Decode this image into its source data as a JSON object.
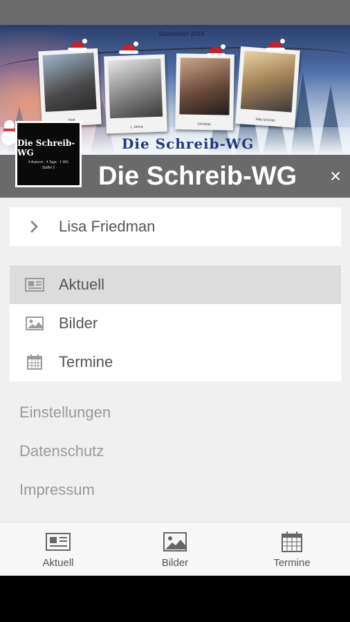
{
  "banner": {
    "month": "Dezember 2018",
    "title": "Die Schreib-WG",
    "logo_title": "Die Schreib-WG",
    "logo_sub": "4 Autoren · 4 Tage · 1 WG",
    "logo_sub2": "· Staffel 2 ·",
    "captions": [
      "Xest",
      "L. Mona",
      "Christian",
      "Mila Schmitz"
    ]
  },
  "header": {
    "title": "Die Schreib-WG",
    "close_glyph": "×"
  },
  "user": {
    "name": "Lisa Friedman"
  },
  "menu": {
    "items": [
      {
        "label": "Aktuell",
        "icon": "newspaper-icon",
        "active": true
      },
      {
        "label": "Bilder",
        "icon": "image-icon",
        "active": false
      },
      {
        "label": "Termine",
        "icon": "calendar-icon",
        "active": false
      }
    ]
  },
  "links": {
    "settings": "Einstellungen",
    "privacy": "Datenschutz",
    "imprint": "Impressum"
  },
  "tabs": [
    {
      "label": "Aktuell",
      "icon": "newspaper-icon"
    },
    {
      "label": "Bilder",
      "icon": "image-icon"
    },
    {
      "label": "Termine",
      "icon": "calendar-icon"
    }
  ],
  "colors": {
    "title_bar": "#6a6a6a",
    "panel_bg": "#f0f0f0",
    "active_row": "#dcdcdc",
    "icon_gray": "#9a9a9a"
  }
}
